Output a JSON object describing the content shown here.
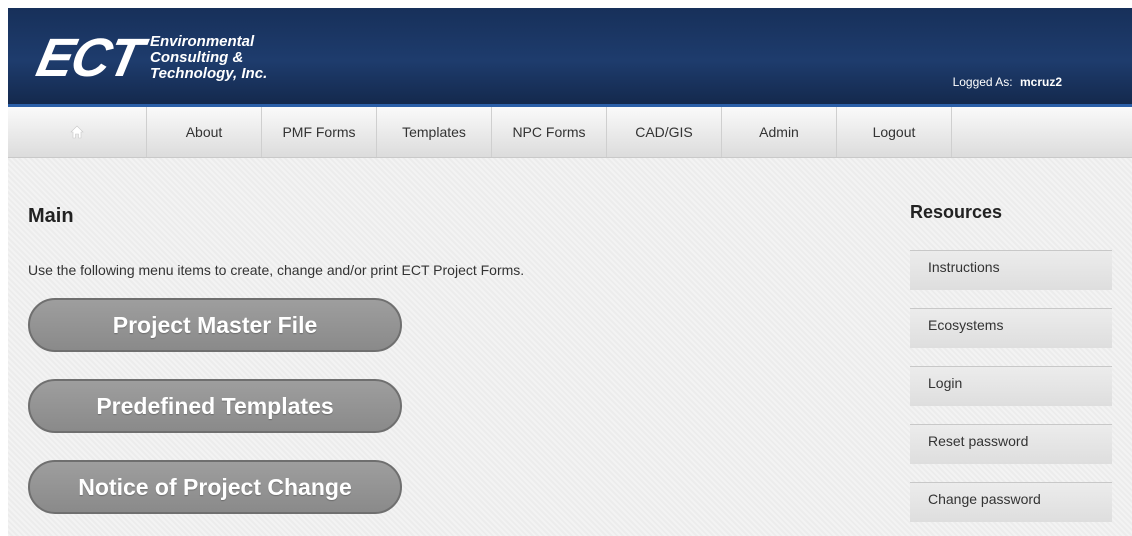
{
  "header": {
    "logo_mark": "ECT",
    "logo_line1": "Environmental",
    "logo_line2": "Consulting &",
    "logo_line3": "Technology, Inc.",
    "logged_label": "Logged As:",
    "username": "mcruz2"
  },
  "nav": {
    "home_icon": "home-icon",
    "items": [
      {
        "label": "About"
      },
      {
        "label": "PMF Forms"
      },
      {
        "label": "Templates"
      },
      {
        "label": "NPC Forms"
      },
      {
        "label": "CAD/GIS"
      },
      {
        "label": "Admin"
      },
      {
        "label": "Logout"
      }
    ]
  },
  "main": {
    "title": "Main",
    "intro": "Use the following menu items to create, change and/or print ECT Project Forms.",
    "buttons": [
      {
        "label": "Project Master File"
      },
      {
        "label": "Predefined Templates"
      },
      {
        "label": "Notice of Project Change"
      }
    ]
  },
  "resources": {
    "title": "Resources",
    "items": [
      {
        "label": "Instructions"
      },
      {
        "label": "Ecosystems"
      },
      {
        "label": "Login"
      },
      {
        "label": "Reset password"
      },
      {
        "label": "Change password"
      }
    ]
  },
  "colors": {
    "header_bg": "#1e3c6d",
    "header_border": "#2b5fa8",
    "button_bg": "#9a9a9a"
  }
}
